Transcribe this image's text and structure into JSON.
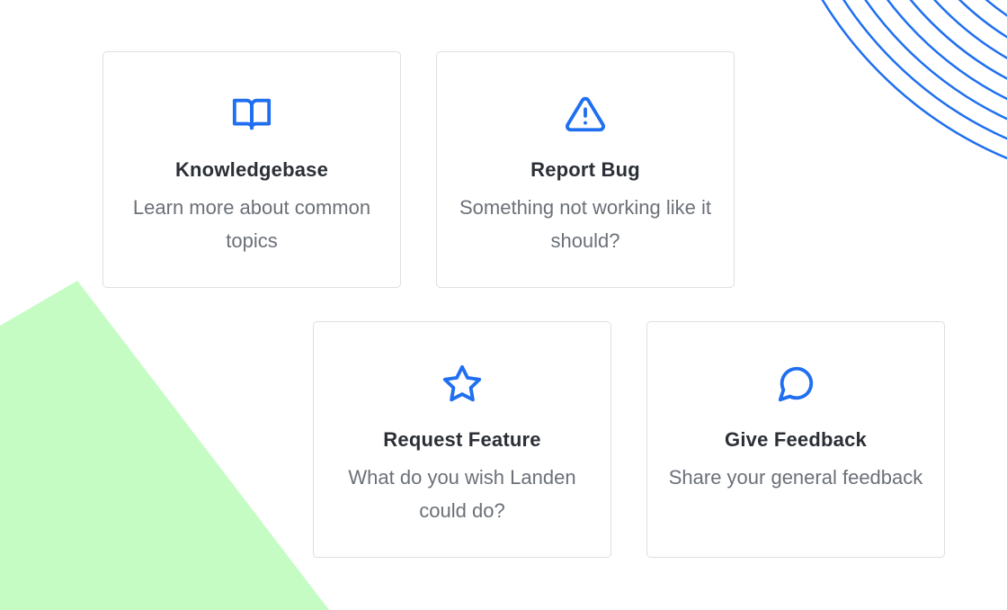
{
  "cards": [
    {
      "id": "knowledgebase",
      "icon": "book-open-icon",
      "title": "Knowledgebase",
      "description": "Learn more about common topics"
    },
    {
      "id": "report-bug",
      "icon": "warning-triangle-icon",
      "title": "Report Bug",
      "description": "Something not working like it should?"
    },
    {
      "id": "request-feature",
      "icon": "star-icon",
      "title": "Request Feature",
      "description": "What do you wish Landen could do?"
    },
    {
      "id": "give-feedback",
      "icon": "chat-bubble-icon",
      "title": "Give Feedback",
      "description": "Share your general feedback"
    }
  ],
  "colors": {
    "accent": "#1f6ff0",
    "green_shape": "#c4fcc4",
    "card_border": "#dcdfe4",
    "title_text": "#2b2f36",
    "desc_text": "#6b7078"
  }
}
